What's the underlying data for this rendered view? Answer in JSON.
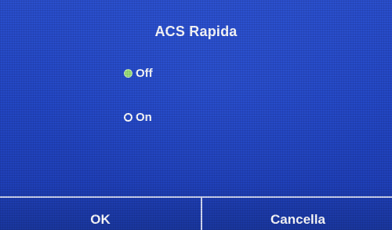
{
  "dialog": {
    "title": "ACS Rapida"
  },
  "options": [
    {
      "label": "Off",
      "selected": true
    },
    {
      "label": "On",
      "selected": false
    }
  ],
  "buttons": {
    "ok_label": "OK",
    "cancel_label": "Cancella"
  },
  "colors": {
    "background": "#2347c4",
    "selected_radio": "#9be07a",
    "text": "#ffffff"
  }
}
